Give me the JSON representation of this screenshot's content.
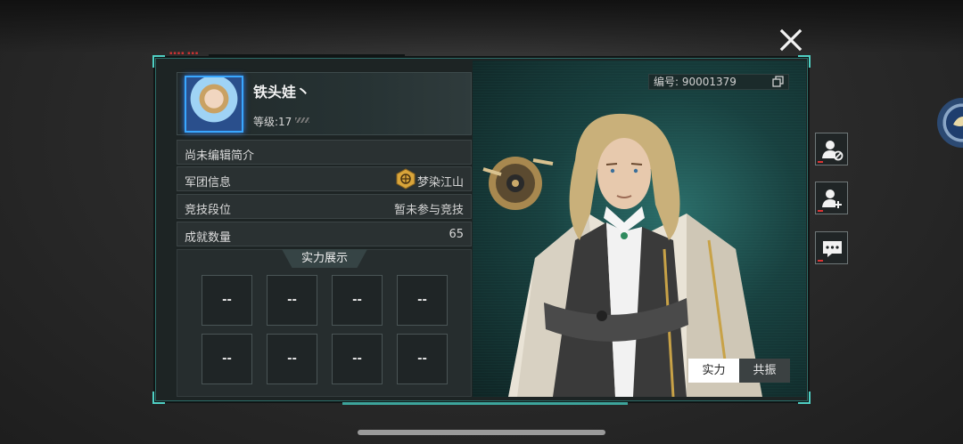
{
  "profile": {
    "name": "铁头娃丶",
    "level": "等级:17",
    "bio": "尚未编辑简介"
  },
  "info_rows": [
    {
      "label": "军团信息",
      "value": "梦染江山"
    },
    {
      "label": "竞技段位",
      "value": "暂未参与竞技"
    },
    {
      "label": "成就数量",
      "value": "65"
    }
  ],
  "showcase": {
    "title": "实力展示",
    "slots": [
      "--",
      "--",
      "--",
      "--",
      "--",
      "--",
      "--",
      "--"
    ]
  },
  "id_label": "编号: 90001379",
  "tabs": {
    "power": "实力",
    "resonance": "共振"
  },
  "colors": {
    "accent": "#4fd0c4",
    "avatar_frame": "#39a7ff",
    "guild_badge": "#d9a53a"
  }
}
